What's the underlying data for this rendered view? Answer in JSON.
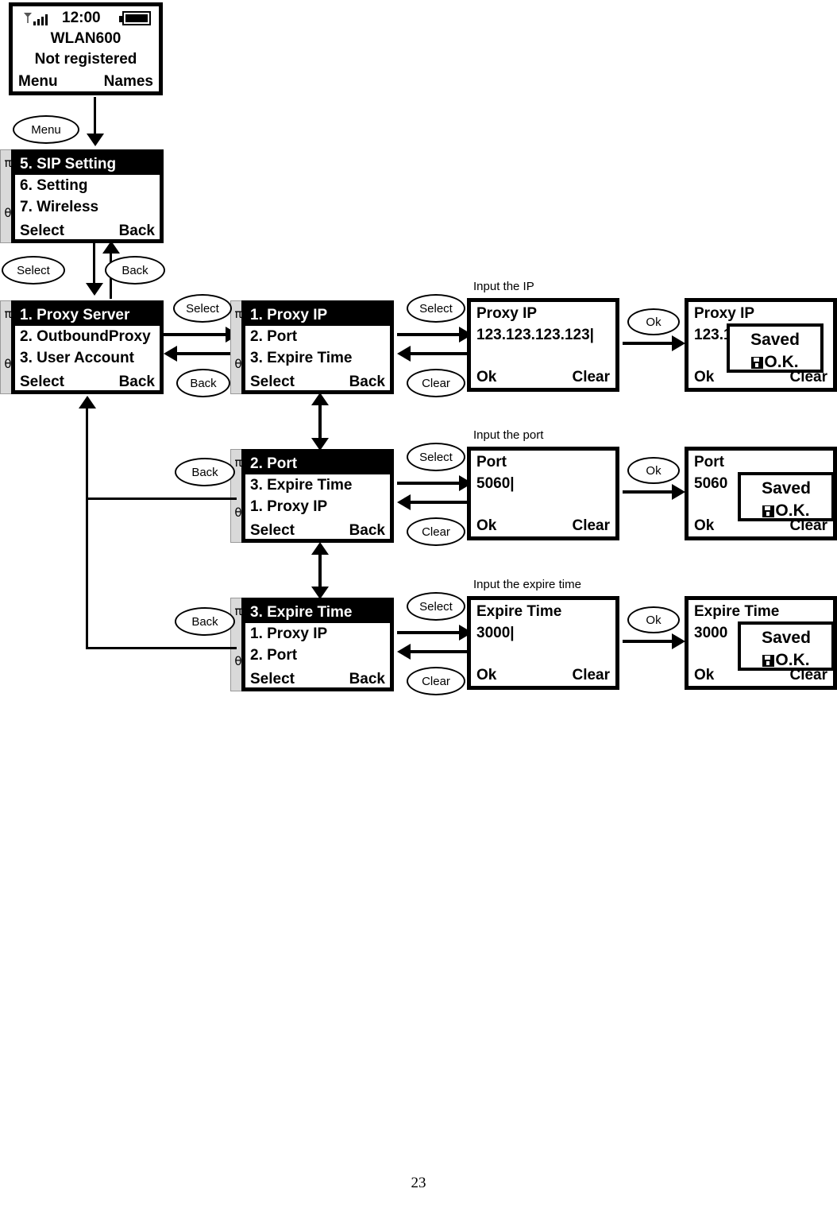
{
  "page": {
    "number": "23"
  },
  "idle_screen": {
    "name": "idle-standby-screen",
    "clock": "12:00",
    "signal_icon": "signal-bars-icon",
    "battery_icon": "battery-icon",
    "model": "WLAN600",
    "status": "Not registered",
    "softkey_left": "Menu",
    "softkey_right": "Names"
  },
  "buttons": {
    "menu": "Menu",
    "select": "Select",
    "back": "Back",
    "clear": "Clear",
    "ok": "Ok"
  },
  "main_menu": {
    "name": "main-menu-screen",
    "items": [
      {
        "label": "5. SIP Setting",
        "selected": true
      },
      {
        "label": "6. Setting",
        "selected": false
      },
      {
        "label": "7. Wireless",
        "selected": false
      }
    ],
    "softkey_left": "Select",
    "softkey_right": "Back",
    "scroll_up": "π",
    "scroll_down": "θ"
  },
  "sip_menu": {
    "name": "sip-setting-menu-screen",
    "items": [
      {
        "label": "1. Proxy Server",
        "selected": true
      },
      {
        "label": "2. OutboundProxy",
        "selected": false
      },
      {
        "label": "3. User Account",
        "selected": false
      }
    ],
    "softkey_left": "Select",
    "softkey_right": "Back",
    "scroll_up": "π",
    "scroll_down": "θ"
  },
  "proxy_menu_1": {
    "name": "proxy-server-menu-proxy-ip-screen",
    "items": [
      {
        "label": "1. Proxy IP",
        "selected": true
      },
      {
        "label": "2. Port",
        "selected": false
      },
      {
        "label": "3. Expire Time",
        "selected": false
      }
    ],
    "softkey_left": "Select",
    "softkey_right": "Back",
    "scroll_up": "π",
    "scroll_down": "θ"
  },
  "proxy_menu_2": {
    "name": "proxy-server-menu-port-screen",
    "items": [
      {
        "label": "2. Port",
        "selected": true
      },
      {
        "label": "3. Expire Time",
        "selected": false
      },
      {
        "label": "1. Proxy IP",
        "selected": false
      }
    ],
    "softkey_left": "Select",
    "softkey_right": "Back",
    "scroll_up": "π",
    "scroll_down": "θ"
  },
  "proxy_menu_3": {
    "name": "proxy-server-menu-expire-time-screen",
    "items": [
      {
        "label": "3. Expire Time",
        "selected": true
      },
      {
        "label": "1. Proxy IP",
        "selected": false
      },
      {
        "label": "2. Port",
        "selected": false
      }
    ],
    "softkey_left": "Select",
    "softkey_right": "Back",
    "scroll_up": "π",
    "scroll_down": "θ"
  },
  "flows": [
    {
      "caption": "Input the IP",
      "input_screen": {
        "name": "proxy-ip-input-screen",
        "title": "Proxy IP",
        "value": "123.123.123.123|",
        "softkey_left": "Ok",
        "softkey_right": "Clear"
      },
      "saved_screen": {
        "name": "proxy-ip-saved-screen",
        "title": "Proxy IP",
        "value": "123.123.123.123",
        "softkey_left": "Ok",
        "softkey_right": "Clear",
        "popup_line1": "Saved",
        "popup_line2": "O.K.",
        "popup_icon": "save-disk-icon"
      }
    },
    {
      "caption": "Input the port",
      "input_screen": {
        "name": "port-input-screen",
        "title": "Port",
        "value": "5060|",
        "softkey_left": "Ok",
        "softkey_right": "Clear"
      },
      "saved_screen": {
        "name": "port-saved-screen",
        "title": "Port",
        "value": "5060",
        "softkey_left": "Ok",
        "softkey_right": "Clear",
        "popup_line1": "Saved",
        "popup_line2": "O.K.",
        "popup_icon": "save-disk-icon"
      }
    },
    {
      "caption": "Input the expire time",
      "input_screen": {
        "name": "expire-time-input-screen",
        "title": "Expire Time",
        "value": "3000|",
        "softkey_left": "Ok",
        "softkey_right": "Clear"
      },
      "saved_screen": {
        "name": "expire-time-saved-screen",
        "title": "Expire Time",
        "value": "3000",
        "softkey_left": "Ok",
        "softkey_right": "Clear",
        "popup_line1": "Saved",
        "popup_line2": "O.K.",
        "popup_icon": "save-disk-icon"
      }
    }
  ]
}
